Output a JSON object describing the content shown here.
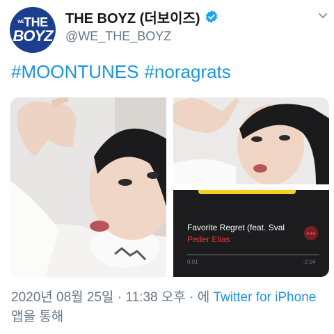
{
  "account": {
    "display_name": "THE BOYZ (더보이즈)",
    "handle": "@WE_THE_BOYZ",
    "avatar_line1": "THE",
    "avatar_line2": "BOYZ",
    "avatar_prefix": "WE",
    "verified_icon": "verified-badge-icon",
    "menu_icon": "chevron-down-icon"
  },
  "tweet": {
    "hashtags": [
      "#MOONTUNES",
      "#noragrats"
    ]
  },
  "music_player": {
    "song_title": "Favorite Regret (feat. Sval",
    "artist": "Peder Elias",
    "elapsed": "0:01",
    "remaining": "-2:54",
    "more_icon": "more-dots-icon"
  },
  "footer": {
    "date": "2020년 08월 25일",
    "sep1": " · ",
    "time": "11:38 오후",
    "sep2": " · ",
    "via_prefix": "에 ",
    "source": "Twitter for iPhone",
    "via_suffix": " 앱을 통해"
  },
  "colors": {
    "link": "#1b95e0",
    "avatar_bg": "#1b3f8e",
    "secondary_text": "#657786",
    "music_accent": "#e53a3a"
  }
}
